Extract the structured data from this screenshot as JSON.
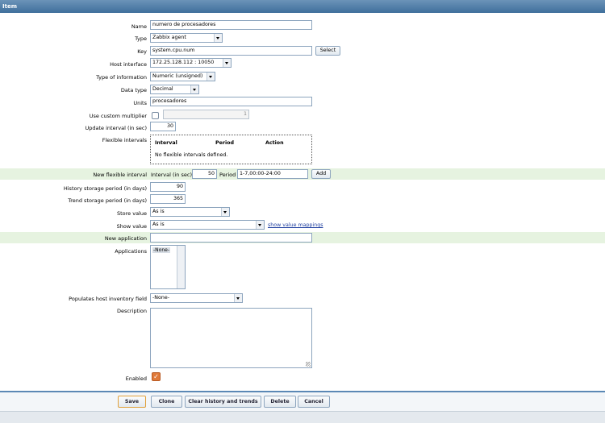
{
  "window": {
    "title": "Item"
  },
  "form": {
    "name": {
      "label": "Name",
      "value": "numero de procesadores"
    },
    "type": {
      "label": "Type",
      "value": "Zabbix agent"
    },
    "key": {
      "label": "Key",
      "value": "system.cpu.num",
      "select_label": "Select"
    },
    "host_interface": {
      "label": "Host interface",
      "value": "172.25.128.112 : 10050"
    },
    "type_of_information": {
      "label": "Type of information",
      "value": "Numeric (unsigned)"
    },
    "data_type": {
      "label": "Data type",
      "value": "Decimal"
    },
    "units": {
      "label": "Units",
      "value": "procesadores"
    },
    "custom_multiplier": {
      "label": "Use custom multiplier",
      "value": "1",
      "checked": false
    },
    "update_interval": {
      "label": "Update interval (in sec)",
      "value": "30"
    },
    "flexible_intervals": {
      "label": "Flexible intervals",
      "columns": [
        "Interval",
        "Period",
        "Action"
      ],
      "empty_text": "No flexible intervals defined."
    },
    "new_flexible_interval": {
      "label": "New flexible interval",
      "interval_label": "Interval (in sec)",
      "interval_value": "50",
      "period_label": "Period",
      "period_value": "1-7,00:00-24:00",
      "add_label": "Add"
    },
    "history": {
      "label": "History storage period (in days)",
      "value": "90"
    },
    "trends": {
      "label": "Trend storage period (in days)",
      "value": "365"
    },
    "store_value": {
      "label": "Store value",
      "value": "As is"
    },
    "show_value": {
      "label": "Show value",
      "value": "As is",
      "link": "show value mappings"
    },
    "new_application": {
      "label": "New application",
      "value": ""
    },
    "applications": {
      "label": "Applications",
      "options": [
        "-None-"
      ]
    },
    "inventory_field": {
      "label": "Populates host inventory field",
      "value": "-None-"
    },
    "description": {
      "label": "Description",
      "value": ""
    },
    "enabled": {
      "label": "Enabled",
      "checked": true
    }
  },
  "footer": {
    "save": "Save",
    "clone": "Clone",
    "clear_history": "Clear history and trends",
    "delete": "Delete",
    "cancel": "Cancel"
  },
  "colors": {
    "accent": "#e07a3a",
    "title_bar": "#4a78a4",
    "highlight_row": "#e6f3e0"
  }
}
